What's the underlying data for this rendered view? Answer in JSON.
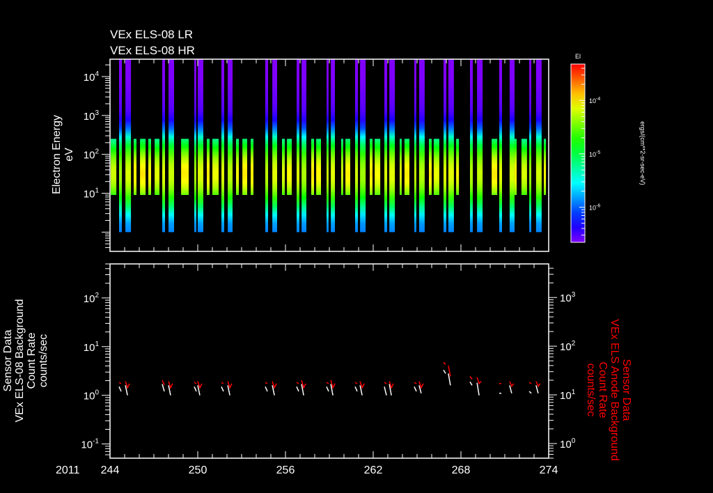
{
  "chart_data": [
    {
      "type": "heatmap",
      "title_lines": [
        "VEx ELS-08 LR",
        "VEx ELS-08 HR"
      ],
      "ylabel_lines": [
        "Electron Energy",
        "eV"
      ],
      "yscale": "log",
      "ylim": [
        0.32,
        28000
      ],
      "yticks": [
        {
          "base": "10",
          "exp": "1",
          "value": 10
        },
        {
          "base": "10",
          "exp": "2",
          "value": 100
        },
        {
          "base": "10",
          "exp": "3",
          "value": 1000
        },
        {
          "base": "10",
          "exp": "4",
          "value": 10000
        }
      ],
      "xlim": [
        244,
        274
      ],
      "colorbar": {
        "title": "El",
        "label": "ergs/(cm**2-sr-sec-eV)",
        "scale": "log",
        "range": [
          2.2e-07,
          0.00048
        ],
        "ticks": [
          {
            "base": "10",
            "exp": "-4",
            "value": 0.0001
          },
          {
            "base": "10",
            "exp": "-5",
            "value": 1e-05
          },
          {
            "base": "10",
            "exp": "-6",
            "value": 1e-06
          }
        ]
      },
      "lr_energy_range": [
        1,
        28000
      ],
      "hr_energy_range": [
        9,
        250
      ],
      "lr_bars": [
        [
          244.62,
          244.81
        ],
        [
          245.05,
          245.43
        ],
        [
          247.57,
          247.76
        ],
        [
          248.0,
          248.38
        ],
        [
          249.76,
          249.9
        ],
        [
          250.0,
          250.38
        ],
        [
          251.62,
          251.81
        ],
        [
          252.05,
          252.38
        ],
        [
          254.62,
          254.81
        ],
        [
          255.1,
          255.43
        ],
        [
          256.76,
          256.95
        ],
        [
          257.1,
          257.43
        ],
        [
          258.81,
          258.95
        ],
        [
          259.1,
          259.38
        ],
        [
          260.76,
          260.95
        ],
        [
          261.1,
          261.48
        ],
        [
          262.76,
          262.95
        ],
        [
          263.1,
          263.48
        ],
        [
          264.81,
          264.95
        ],
        [
          265.14,
          265.52
        ],
        [
          266.81,
          267.0
        ],
        [
          267.14,
          267.52
        ],
        [
          268.62,
          268.81
        ],
        [
          269.1,
          269.48
        ],
        [
          270.62,
          270.81
        ],
        [
          271.33,
          271.67
        ],
        [
          272.67,
          272.81
        ],
        [
          273.14,
          273.52
        ]
      ],
      "hr_bars": [
        [
          244.05,
          244.43
        ],
        [
          245.62,
          245.81
        ],
        [
          246.05,
          246.43
        ],
        [
          246.62,
          246.81
        ],
        [
          247.05,
          247.38
        ],
        [
          248.86,
          249.38
        ],
        [
          250.62,
          250.81
        ],
        [
          251.0,
          251.43
        ],
        [
          252.62,
          252.81
        ],
        [
          253.05,
          253.38
        ],
        [
          253.62,
          253.81
        ],
        [
          255.76,
          255.95
        ],
        [
          256.1,
          256.43
        ],
        [
          257.76,
          257.95
        ],
        [
          258.1,
          258.43
        ],
        [
          259.81,
          259.95
        ],
        [
          260.1,
          260.43
        ],
        [
          261.76,
          261.95
        ],
        [
          262.1,
          262.48
        ],
        [
          263.81,
          263.95
        ],
        [
          264.14,
          264.48
        ],
        [
          265.81,
          266.0
        ],
        [
          266.14,
          266.52
        ],
        [
          267.67,
          267.86
        ],
        [
          270.1,
          270.48
        ],
        [
          271.67,
          271.81
        ],
        [
          272.14,
          272.52
        ],
        [
          273.67,
          273.81
        ]
      ],
      "peak_flux_lr": 6e-05,
      "peak_flux_hr": 8e-05
    },
    {
      "type": "line",
      "left_ylabel_lines": [
        "Sensor Data",
        "VEx ELS-08 Background",
        "Count Rate",
        "counts/sec"
      ],
      "right_ylabel_lines": [
        "Sensor Data",
        "VEx ELS Anode Background",
        "Count Rate",
        "counts/sec"
      ],
      "left_yscale": "log",
      "left_ylim": [
        0.051,
        500
      ],
      "right_yscale": "log",
      "right_ylim": [
        0.5,
        4900
      ],
      "left_yticks": [
        {
          "base": "10",
          "exp": "-1",
          "value": 0.1
        },
        {
          "base": "10",
          "exp": "0",
          "value": 1
        },
        {
          "base": "10",
          "exp": "1",
          "value": 10
        },
        {
          "base": "10",
          "exp": "2",
          "value": 100
        }
      ],
      "right_yticks": [
        {
          "base": "10",
          "exp": "0",
          "value": 1
        },
        {
          "base": "10",
          "exp": "1",
          "value": 10
        },
        {
          "base": "10",
          "exp": "2",
          "value": 100
        },
        {
          "base": "10",
          "exp": "3",
          "value": 1000
        }
      ],
      "xlim": [
        244,
        274
      ],
      "xticks": [
        "244",
        "250",
        "256",
        "262",
        "268",
        "274"
      ],
      "xtick_values": [
        244,
        250,
        256,
        262,
        268,
        274
      ],
      "year_label": "2011",
      "series": [
        {
          "name": "VEx ELS-08 Background",
          "axis": "left",
          "color": "#ffffff",
          "events": [
            {
              "day": 244.62,
              "v": [
                1.5,
                1.2
              ]
            },
            {
              "day": 245.05,
              "v": [
                1.6,
                1.0
              ]
            },
            {
              "day": 247.57,
              "v": [
                1.7,
                1.2
              ]
            },
            {
              "day": 248.0,
              "v": [
                1.6,
                1.0
              ]
            },
            {
              "day": 249.76,
              "v": [
                1.5,
                1.2
              ]
            },
            {
              "day": 250.0,
              "v": [
                1.6,
                1.0
              ]
            },
            {
              "day": 251.62,
              "v": [
                1.5,
                1.2
              ]
            },
            {
              "day": 252.05,
              "v": [
                1.6,
                1.0
              ]
            },
            {
              "day": 254.62,
              "v": [
                1.5,
                1.2
              ]
            },
            {
              "day": 255.1,
              "v": [
                1.6,
                1.0
              ]
            },
            {
              "day": 256.76,
              "v": [
                1.5,
                1.2
              ]
            },
            {
              "day": 257.1,
              "v": [
                1.7,
                1.0
              ]
            },
            {
              "day": 258.81,
              "v": [
                1.5,
                1.2
              ]
            },
            {
              "day": 259.1,
              "v": [
                1.7,
                1.0
              ]
            },
            {
              "day": 260.76,
              "v": [
                1.5,
                1.2
              ]
            },
            {
              "day": 261.1,
              "v": [
                1.6,
                1.0
              ]
            },
            {
              "day": 262.76,
              "v": [
                1.5,
                1.0
              ]
            },
            {
              "day": 263.1,
              "v": [
                1.7,
                1.0
              ]
            },
            {
              "day": 264.81,
              "v": [
                1.5,
                1.2
              ]
            },
            {
              "day": 265.14,
              "v": [
                1.6,
                1.1
              ]
            },
            {
              "day": 266.81,
              "v": [
                3.3,
                2.8
              ]
            },
            {
              "day": 267.14,
              "v": [
                2.8,
                1.6
              ]
            },
            {
              "day": 268.62,
              "v": [
                1.9,
                1.6
              ]
            },
            {
              "day": 269.1,
              "v": [
                1.8,
                1.0
              ]
            },
            {
              "day": 270.62,
              "v": [
                1.1,
                1.1
              ]
            },
            {
              "day": 271.33,
              "v": [
                1.6,
                1.1
              ]
            },
            {
              "day": 272.67,
              "v": [
                1.2,
                1.1
              ]
            },
            {
              "day": 273.14,
              "v": [
                1.6,
                1.1
              ]
            }
          ]
        },
        {
          "name": "VEx ELS Anode Background",
          "axis": "right",
          "color": "#ff0000",
          "events": [
            {
              "day": 244.62,
              "v": [
                18,
                17
              ]
            },
            {
              "day": 245.05,
              "v": [
                19,
                14,
                17
              ]
            },
            {
              "day": 247.57,
              "v": [
                20,
                16
              ]
            },
            {
              "day": 248.0,
              "v": [
                19,
                14,
                17
              ]
            },
            {
              "day": 249.76,
              "v": [
                18,
                17
              ]
            },
            {
              "day": 250.0,
              "v": [
                19,
                14,
                17
              ]
            },
            {
              "day": 251.62,
              "v": [
                18,
                17
              ]
            },
            {
              "day": 252.05,
              "v": [
                19,
                14,
                17
              ]
            },
            {
              "day": 254.62,
              "v": [
                18,
                17
              ]
            },
            {
              "day": 255.1,
              "v": [
                19,
                14,
                17
              ]
            },
            {
              "day": 256.76,
              "v": [
                18,
                17
              ]
            },
            {
              "day": 257.1,
              "v": [
                20,
                14,
                17
              ]
            },
            {
              "day": 258.81,
              "v": [
                18,
                17
              ]
            },
            {
              "day": 259.1,
              "v": [
                20,
                14,
                17
              ]
            },
            {
              "day": 260.76,
              "v": [
                18,
                17
              ]
            },
            {
              "day": 261.1,
              "v": [
                19,
                14,
                17
              ]
            },
            {
              "day": 262.76,
              "v": [
                18,
                17
              ]
            },
            {
              "day": 263.1,
              "v": [
                19,
                14,
                17
              ]
            },
            {
              "day": 264.81,
              "v": [
                18,
                17
              ]
            },
            {
              "day": 265.14,
              "v": [
                19,
                14,
                17
              ]
            },
            {
              "day": 266.81,
              "v": [
                47,
                42
              ]
            },
            {
              "day": 267.14,
              "v": [
                40,
                24
              ]
            },
            {
              "day": 268.62,
              "v": [
                24,
                21
              ]
            },
            {
              "day": 269.1,
              "v": [
                23,
                17,
                19
              ]
            },
            {
              "day": 270.62,
              "v": [
                17,
                17
              ]
            },
            {
              "day": 271.33,
              "v": [
                19,
                15,
                17
              ]
            },
            {
              "day": 272.67,
              "v": [
                18,
                17
              ]
            },
            {
              "day": 273.14,
              "v": [
                19,
                15,
                17
              ]
            }
          ]
        }
      ]
    }
  ]
}
